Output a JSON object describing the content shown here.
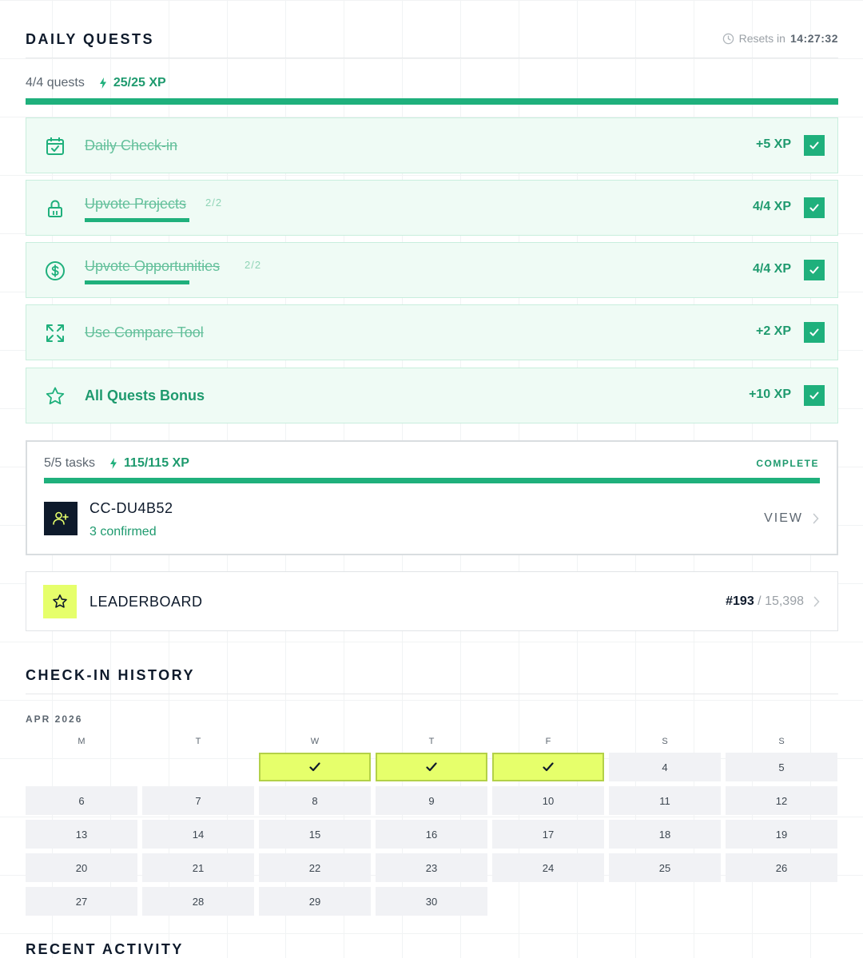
{
  "daily_quests": {
    "title": "DAILY QUESTS",
    "reset_label": "Resets in",
    "reset_time": "14:27:32",
    "quests_count": "4/4 quests",
    "xp_total": "25/25 XP",
    "progress": 1.0,
    "quests": [
      {
        "name": "Daily Check-in",
        "xp": "+5 XP",
        "icon": "calendar-check-icon",
        "done": true
      },
      {
        "name": "Upvote Projects",
        "count": "2/2",
        "xp": "4/4 XP",
        "icon": "lock-icon",
        "done": true,
        "progress": 1.0
      },
      {
        "name": "Upvote Opportunities",
        "count": "2/2",
        "xp": "4/4 XP",
        "icon": "dollar-circle-icon",
        "done": true,
        "progress": 1.0
      },
      {
        "name": "Use Compare Tool",
        "xp": "+2 XP",
        "icon": "expand-arrows-icon",
        "done": true
      },
      {
        "name": "All Quests Bonus",
        "xp": "+10 XP",
        "icon": "star-icon",
        "done": true
      }
    ]
  },
  "referral": {
    "tasks": "5/5 tasks",
    "xp": "115/115 XP",
    "status": "COMPLETE",
    "progress": 1.0,
    "code": "CC-DU4B52",
    "confirmed": "3 confirmed",
    "view_label": "VIEW"
  },
  "leaderboard": {
    "title": "LEADERBOARD",
    "rank": "#193",
    "total": "/ 15,398"
  },
  "checkin_history": {
    "title": "CHECK-IN HISTORY",
    "month": "APR 2026",
    "weekdays": [
      "M",
      "T",
      "W",
      "T",
      "F",
      "S",
      "S"
    ],
    "checked_days": [
      1,
      2,
      3
    ],
    "days": [
      "4",
      "5",
      "6",
      "7",
      "8",
      "9",
      "10",
      "11",
      "12",
      "13",
      "14",
      "15",
      "16",
      "17",
      "18",
      "19",
      "20",
      "21",
      "22",
      "23",
      "24",
      "25",
      "26",
      "27",
      "28",
      "29",
      "30"
    ]
  },
  "recent_activity": {
    "title": "RECENT ACTIVITY"
  }
}
